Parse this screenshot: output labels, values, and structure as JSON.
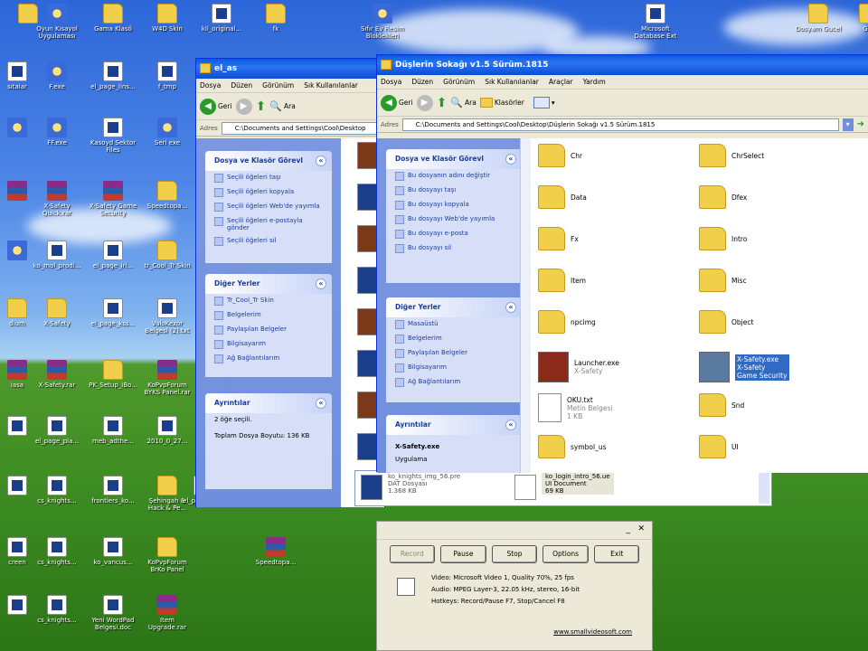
{
  "desktop": {
    "icons": [
      {
        "label": "",
        "type": "folder"
      },
      {
        "label": "Oyun Kısayol Uygulaması",
        "type": "app"
      },
      {
        "label": "Gama Klasö",
        "type": "folder"
      },
      {
        "label": "W4D Skin",
        "type": "folder"
      },
      {
        "label": "kil_original...",
        "type": "doc"
      },
      {
        "label": "fk",
        "type": "folder"
      },
      {
        "label": "Sıfır Ev Resim Bloklekleri",
        "type": "app"
      },
      {
        "label": "Microsoft Database Ext",
        "type": "doc"
      },
      {
        "label": "Dosyam Gucel",
        "type": "folder"
      },
      {
        "label": "Gec",
        "type": "folder"
      },
      {
        "label": "sıtalar",
        "type": "doc"
      },
      {
        "label": "F.exe",
        "type": "app"
      },
      {
        "label": "el_page_lins...",
        "type": "doc"
      },
      {
        "label": "f_tmp",
        "type": "doc"
      },
      {
        "label": "",
        "type": "app"
      },
      {
        "label": "FF.exe",
        "type": "app"
      },
      {
        "label": "Kasoyd Sektor Files",
        "type": "doc"
      },
      {
        "label": "Seri exe",
        "type": "app"
      },
      {
        "label": "",
        "type": "rar"
      },
      {
        "label": "X-Safety Quick.rar",
        "type": "rar"
      },
      {
        "label": "X-Safety Game Security",
        "type": "rar"
      },
      {
        "label": "Speedtopa...",
        "type": "folder"
      },
      {
        "label": "",
        "type": "app"
      },
      {
        "label": "ko_mol_prodi...",
        "type": "doc"
      },
      {
        "label": "el_page_iri...",
        "type": "doc"
      },
      {
        "label": "tr_Cool_Tr Skin",
        "type": "folder"
      },
      {
        "label": "dium",
        "type": "folder"
      },
      {
        "label": "X-Safety",
        "type": "folder"
      },
      {
        "label": "el_page_kss...",
        "type": "doc"
      },
      {
        "label": "ValoKezor Belgesi (2).txt",
        "type": "doc"
      },
      {
        "label": "iasa",
        "type": "rar"
      },
      {
        "label": "X-Safety.rar",
        "type": "rar"
      },
      {
        "label": "PK_Setup_iBo...",
        "type": "folder"
      },
      {
        "label": "KoPvpForum BYKS Panel.rar",
        "type": "rar"
      },
      {
        "label": "",
        "type": "doc"
      },
      {
        "label": "el_page_pla...",
        "type": "doc"
      },
      {
        "label": "meb_adthe...",
        "type": "doc"
      },
      {
        "label": "2010_0_27...",
        "type": "doc"
      },
      {
        "label": "",
        "type": "doc"
      },
      {
        "label": "cs_knights...",
        "type": "doc"
      },
      {
        "label": "frontiers_ko...",
        "type": "doc"
      },
      {
        "label": "Şehingah & Hack & Pe...",
        "type": "folder"
      },
      {
        "label": "el_page_kn...",
        "type": "doc"
      },
      {
        "label": "creen",
        "type": "doc"
      },
      {
        "label": "cs_knights...",
        "type": "doc"
      },
      {
        "label": "ko_vancus...",
        "type": "doc"
      },
      {
        "label": "KoPvpForum BrKo Panel",
        "type": "folder"
      },
      {
        "label": "Speedtopa...",
        "type": "rar"
      },
      {
        "label": "",
        "type": "doc"
      },
      {
        "label": "cs_knights...",
        "type": "doc"
      },
      {
        "label": "Yeni WordPad Belgesi.doc",
        "type": "doc"
      },
      {
        "label": "Item Upgrade.rar",
        "type": "rar"
      }
    ]
  },
  "win1": {
    "title": "el_as",
    "menu": [
      "Dosya",
      "Düzen",
      "Görünüm",
      "Sık Kullanılanlar"
    ],
    "back": "Geri",
    "search": "Ara",
    "addr_label": "Adres",
    "addr": "C:\\Documents and Settings\\Cool\\Desktop",
    "tasks": {
      "title": "Dosya ve Klasör Görevl",
      "items": [
        "Seçili öğeleri taşı",
        "Seçili öğeleri kopyala",
        "Seçili öğeleri Web'de yayımla",
        "Seçili öğeleri e-postayla gönder",
        "Seçili öğeleri sil"
      ]
    },
    "places": {
      "title": "Diğer Yerler",
      "items": [
        "Tr_Cool_Tr Skin",
        "Belgelerim",
        "Paylaşılan Belgeler",
        "Bilgisayarım",
        "Ağ Bağlantılarım"
      ]
    },
    "details": {
      "title": "Ayrıntılar",
      "l1": "2 öğe seçili.",
      "l2": "Toplam Dosya Boyutu: 136 KB"
    },
    "bottom": [
      {
        "name": "ko_knights_img_56.pre",
        "sub1": "DAT Dosyası",
        "sub2": "1.368 KB"
      },
      {
        "name": "ko_login_intro_56.ue",
        "sub1": "UI Document",
        "sub2": "69 KB"
      }
    ]
  },
  "win2": {
    "title": "Düşlerin Sokağı v1.5 Sürüm.1815",
    "menu": [
      "Dosya",
      "Düzen",
      "Görünüm",
      "Sık Kullanılanlar",
      "Araçlar",
      "Yardım"
    ],
    "back": "Geri",
    "search": "Ara",
    "folders": "Klasörler",
    "addr_label": "Adres",
    "addr": "C:\\Documents and Settings\\Cool\\Desktop\\Düşlerin Sokağı v1.5 Sürüm.1815",
    "tasks": {
      "title": "Dosya ve Klasör Görevl",
      "items": [
        "Bu dosyanın adını değiştir",
        "Bu dosyayı taşı",
        "Bu dosyayı kopyala",
        "Bu dosyayı Web'de yayımla",
        "Bu dosyayı e-posta",
        "Bu dosyayı sil"
      ]
    },
    "places": {
      "title": "Diğer Yerler",
      "items": [
        "Masaüstü",
        "Belgelerim",
        "Paylaşılan Belgeler",
        "Bilgisayarım",
        "Ağ Bağlantılarım"
      ]
    },
    "details": {
      "title": "Ayrıntılar",
      "name": "X-Safety.exe",
      "type": "Uygulama"
    },
    "files": [
      {
        "name": "Chr",
        "kind": "folder"
      },
      {
        "name": "ChrSelect",
        "kind": "folder"
      },
      {
        "name": "Data",
        "kind": "folder"
      },
      {
        "name": "Dfex",
        "kind": "folder"
      },
      {
        "name": "Fx",
        "kind": "folder"
      },
      {
        "name": "Intro",
        "kind": "folder"
      },
      {
        "name": "Item",
        "kind": "folder"
      },
      {
        "name": "Misc",
        "kind": "folder"
      },
      {
        "name": "npcimg",
        "kind": "folder"
      },
      {
        "name": "Object",
        "kind": "folder"
      },
      {
        "name": "Launcher.exe",
        "sub": "X-Safety",
        "kind": "exe"
      },
      {
        "name": "X-Safety.exe",
        "sub": "X-Safety\nGame Security",
        "kind": "exe-sel"
      },
      {
        "name": "OKU.txt",
        "sub": "Metin Belgesi\n1 KB",
        "kind": "txt"
      },
      {
        "name": "Snd",
        "kind": "folder"
      },
      {
        "name": "symbol_us",
        "kind": "folder"
      },
      {
        "name": "UI",
        "kind": "folder"
      }
    ]
  },
  "recorder": {
    "buttons": [
      "Record",
      "Pause",
      "Stop",
      "Options",
      "Exit"
    ],
    "video": "Video: Microsoft Video 1, Quality 70%, 25 fps",
    "audio": "Audio: MPEG Layer-3, 22.05 kHz, stereo, 16-bit",
    "hotkeys": "Hotkeys: Record/Pause F7, Stop/Cancel F8",
    "link": "www.smallvideosoft.com"
  }
}
